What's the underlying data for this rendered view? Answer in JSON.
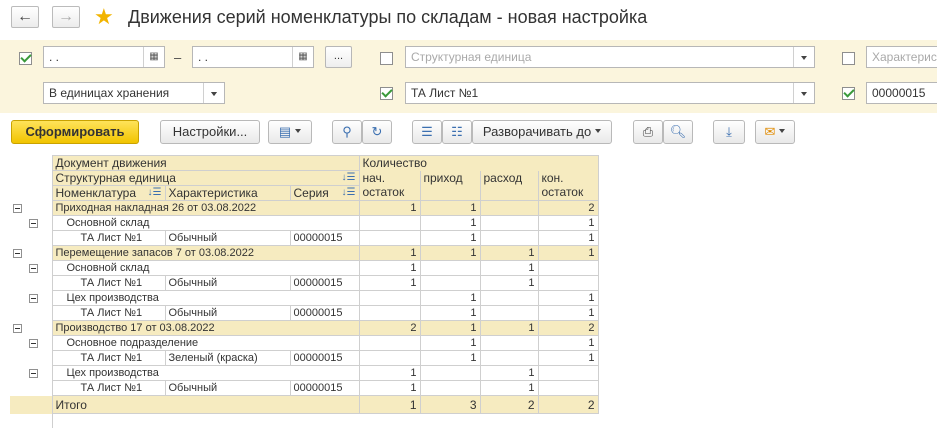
{
  "window": {
    "title": "Движения серий номенклатуры по складам - новая настройка"
  },
  "filters": {
    "period_from": " .  .",
    "period_to": " .  .",
    "period_sep": "–",
    "period_more": "...",
    "units": "В единицах хранения",
    "struct_unit_placeholder": "Структурная единица",
    "characteristic_placeholder": "Характеристика",
    "nomenclature_value": "ТА Лист №1",
    "series_value": "00000015"
  },
  "toolbar": {
    "generate_label": "Сформировать",
    "settings_label": "Настройки...",
    "expand_label": "Разворачивать до"
  },
  "report": {
    "headers": {
      "document": "Документ движения",
      "struct_unit": "Структурная единица",
      "nomenclature": "Номенклатура",
      "characteristic": "Характеристика",
      "series": "Серия",
      "quantity": "Количество",
      "start_balance_1": "нач.",
      "start_balance_2": "остаток",
      "income": "приход",
      "expense": "расход",
      "end_balance_1": "кон.",
      "end_balance_2": "остаток"
    },
    "rows": [
      {
        "level": 0,
        "label": "Приходная накладная 26 от 03.08.2022",
        "start": "1",
        "in": "1",
        "out": "",
        "end": "2"
      },
      {
        "level": 1,
        "label": "Основной склад",
        "start": "",
        "in": "1",
        "out": "",
        "end": "1"
      },
      {
        "level": 2,
        "nom": "ТА Лист №1",
        "char": "Обычный",
        "ser": "00000015",
        "start": "",
        "in": "1",
        "out": "",
        "end": "1"
      },
      {
        "level": 0,
        "label": "Перемещение запасов 7 от 03.08.2022",
        "start": "1",
        "in": "1",
        "out": "1",
        "end": "1"
      },
      {
        "level": 1,
        "label": "Основной склад",
        "start": "1",
        "in": "",
        "out": "1",
        "end": ""
      },
      {
        "level": 2,
        "nom": "ТА Лист №1",
        "char": "Обычный",
        "ser": "00000015",
        "start": "1",
        "in": "",
        "out": "1",
        "end": ""
      },
      {
        "level": 1,
        "label": "Цех производства",
        "start": "",
        "in": "1",
        "out": "",
        "end": "1"
      },
      {
        "level": 2,
        "nom": "ТА Лист №1",
        "char": "Обычный",
        "ser": "00000015",
        "start": "",
        "in": "1",
        "out": "",
        "end": "1"
      },
      {
        "level": 0,
        "label": "Производство 17 от 03.08.2022",
        "start": "2",
        "in": "1",
        "out": "1",
        "end": "2"
      },
      {
        "level": 1,
        "label": "Основное подразделение",
        "start": "",
        "in": "1",
        "out": "",
        "end": "1"
      },
      {
        "level": 2,
        "nom": "ТА Лист №1",
        "char": "Зеленый (краска)",
        "ser": "00000015",
        "start": "",
        "in": "1",
        "out": "",
        "end": "1"
      },
      {
        "level": 1,
        "label": "Цех производства",
        "start": "1",
        "in": "",
        "out": "1",
        "end": ""
      },
      {
        "level": 2,
        "nom": "ТА Лист №1",
        "char": "Обычный",
        "ser": "00000015",
        "start": "1",
        "in": "",
        "out": "1",
        "end": ""
      }
    ],
    "total": {
      "label": "Итого",
      "start": "1",
      "in": "3",
      "out": "2",
      "end": "2"
    }
  }
}
